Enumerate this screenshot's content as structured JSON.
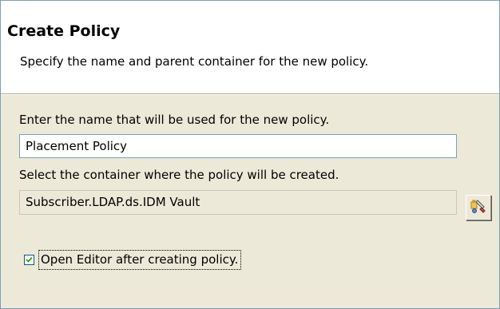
{
  "header": {
    "title": "Create Policy",
    "description": "Specify the name and parent container for the new policy."
  },
  "form": {
    "name_label": "Enter the name that will be used for the new policy.",
    "name_value": "Placement Policy",
    "container_label": "Select the container where the policy will be created.",
    "container_value": "Subscriber.LDAP.ds.IDM  Vault",
    "browse_icon": "browse-container-icon",
    "open_editor_label": "Open Editor after creating policy.",
    "open_editor_checked": true
  },
  "colors": {
    "panel_bg": "#ece9d8",
    "header_bg": "#ffffff",
    "border": "#7f9db9",
    "checkbox_border": "#1c5180"
  }
}
